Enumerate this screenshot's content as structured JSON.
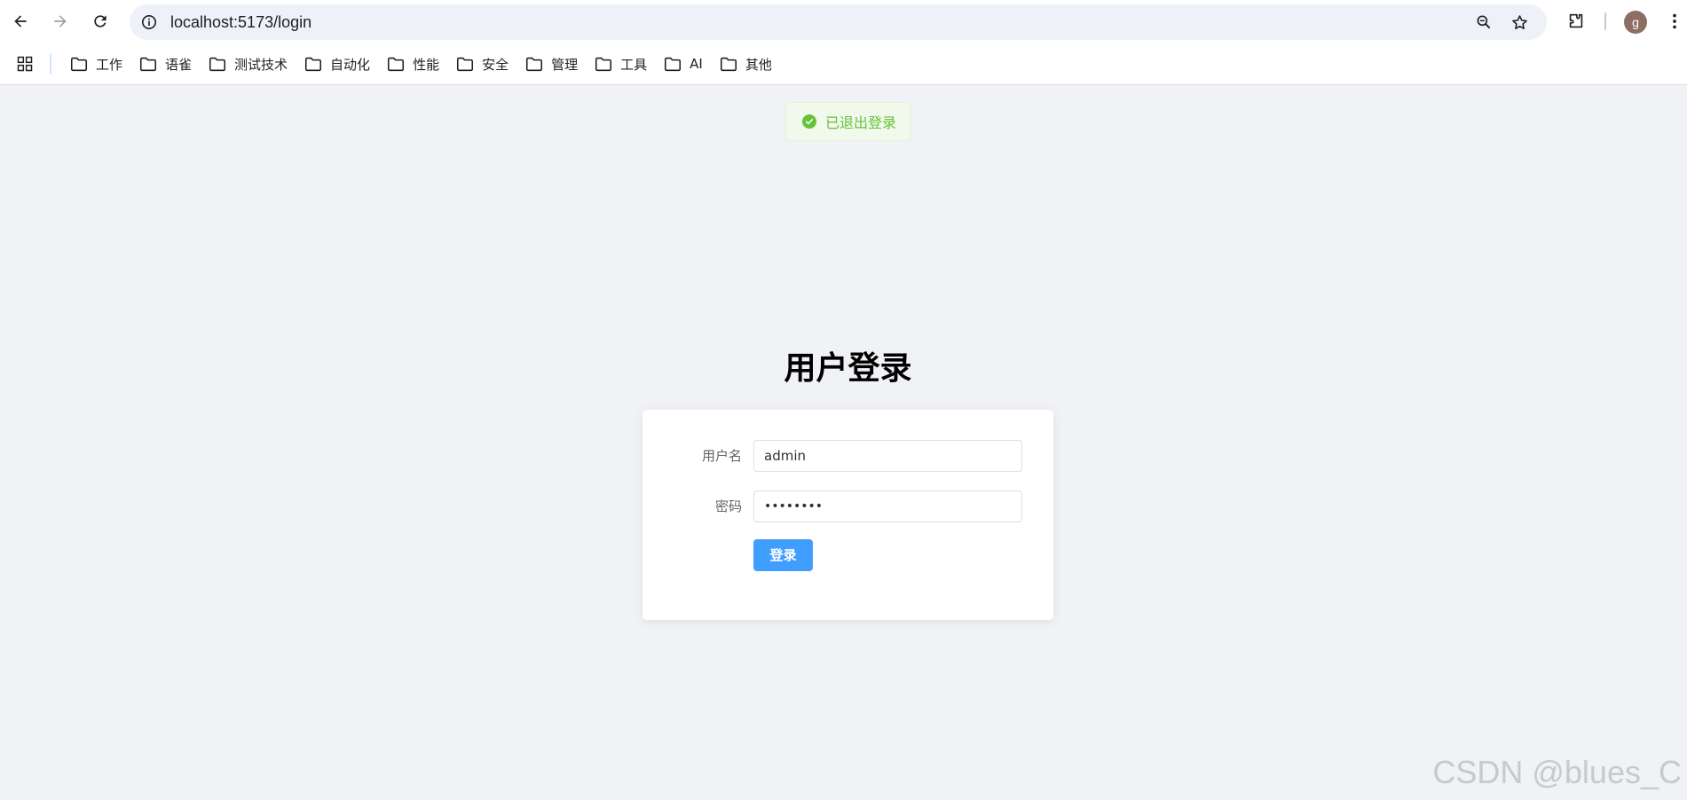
{
  "browser": {
    "url": "localhost:5173/login",
    "avatar_letter": "g",
    "bookmarks": [
      "工作",
      "语雀",
      "测试技术",
      "自动化",
      "性能",
      "安全",
      "管理",
      "工具",
      "AI",
      "其他"
    ]
  },
  "toast": {
    "text": "已退出登录",
    "color": "#67c23a"
  },
  "login": {
    "title": "用户登录",
    "username_label": "用户名",
    "username_value": "admin",
    "password_label": "密码",
    "password_value": "••••••••",
    "submit_label": "登录",
    "accent": "#409eff"
  },
  "watermark": "CSDN @blues_C"
}
